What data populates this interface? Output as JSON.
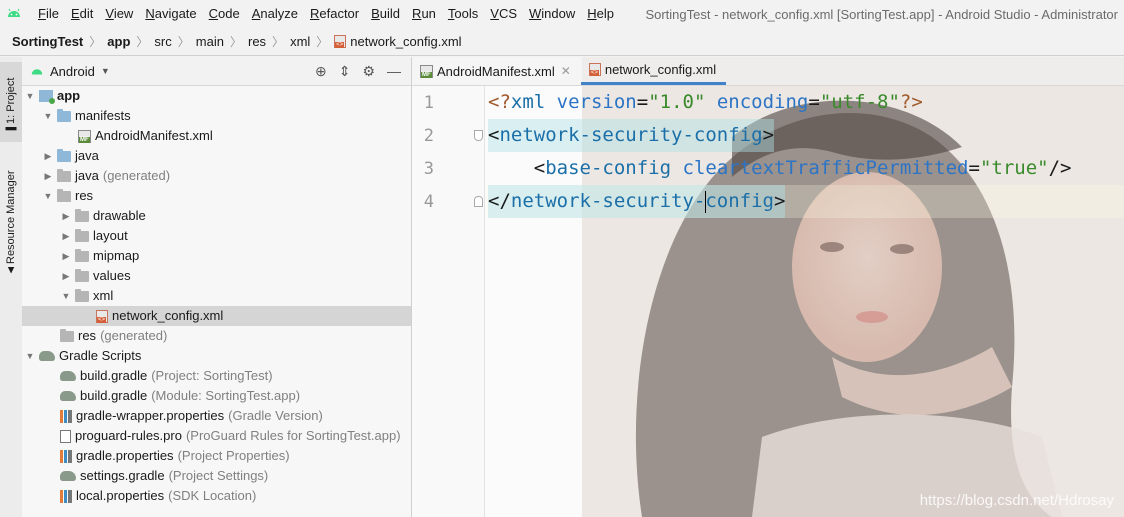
{
  "window_title": "SortingTest - network_config.xml [SortingTest.app] - Android Studio - Administrator",
  "menu": [
    "File",
    "Edit",
    "View",
    "Navigate",
    "Code",
    "Analyze",
    "Refactor",
    "Build",
    "Run",
    "Tools",
    "VCS",
    "Window",
    "Help"
  ],
  "breadcrumb": [
    "SortingTest",
    "app",
    "src",
    "main",
    "res",
    "xml",
    "network_config.xml"
  ],
  "sidebar_tabs": {
    "project": "1: Project",
    "resource": "Resource Manager"
  },
  "project_panel": {
    "view": "Android"
  },
  "tree": {
    "app": "app",
    "manifests": "manifests",
    "android_manifest": "AndroidManifest.xml",
    "java": "java",
    "java_generated": "java",
    "java_generated_hint": "(generated)",
    "res": "res",
    "drawable": "drawable",
    "layout": "layout",
    "mipmap": "mipmap",
    "values": "values",
    "xml": "xml",
    "network_config": "network_config.xml",
    "res_generated": "res",
    "res_generated_hint": "(generated)",
    "gradle_scripts": "Gradle Scripts",
    "gradle_files": [
      {
        "name": "build.gradle",
        "hint": "(Project: SortingTest)",
        "icon": "gradle"
      },
      {
        "name": "build.gradle",
        "hint": "(Module: SortingTest.app)",
        "icon": "gradle"
      },
      {
        "name": "gradle-wrapper.properties",
        "hint": "(Gradle Version)",
        "icon": "props"
      },
      {
        "name": "proguard-rules.pro",
        "hint": "(ProGuard Rules for SortingTest.app)",
        "icon": "pro"
      },
      {
        "name": "gradle.properties",
        "hint": "(Project Properties)",
        "icon": "props"
      },
      {
        "name": "settings.gradle",
        "hint": "(Project Settings)",
        "icon": "gradle"
      },
      {
        "name": "local.properties",
        "hint": "(SDK Location)",
        "icon": "props"
      }
    ]
  },
  "editor_tabs": [
    {
      "label": "AndroidManifest.xml",
      "active": false
    },
    {
      "label": "network_config.xml",
      "active": true
    }
  ],
  "line_numbers": [
    "1",
    "2",
    "3",
    "4"
  ],
  "code": {
    "l1": {
      "open": "<?",
      "tag": "xml",
      "a1": "version",
      "eq1": "=",
      "v1": "\"1.0\"",
      "a2": "encoding",
      "eq2": "=",
      "v2": "\"utf-8\"",
      "close": "?>"
    },
    "l2": {
      "open": "<",
      "tag": "network-security-config",
      "close": ">"
    },
    "l3": {
      "indent": "    ",
      "open": "<",
      "tag": "base-config",
      "attr": "cleartextTrafficPermitted",
      "eq": "=",
      "val": "\"true\"",
      "close": "/>"
    },
    "l4": {
      "open": "</",
      "tag_a": "network-security-",
      "tag_b": "config",
      "close": ">"
    }
  },
  "watermark": "https://blog.csdn.net/Hdrosay",
  "colors": {
    "accent": "#4083c9",
    "selection": "#d5d5d5",
    "tag_highlight": "#b0e0e6"
  }
}
